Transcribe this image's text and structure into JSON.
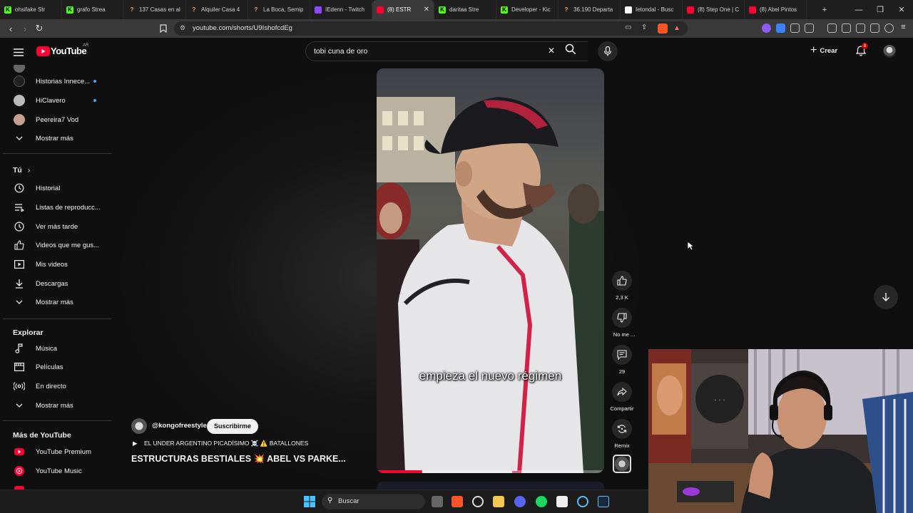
{
  "browser": {
    "tabs": [
      {
        "label": "ohsifake Str",
        "icon": "kick-icon",
        "color": "#53fc18"
      },
      {
        "label": "grafo Strea",
        "icon": "kick-icon",
        "color": "#53fc18"
      },
      {
        "label": "137 Casas en al",
        "icon": "question-icon",
        "color": "#f4a261"
      },
      {
        "label": "Alquiler Casa 4",
        "icon": "question-icon",
        "color": "#f4a261"
      },
      {
        "label": "La Boca, Semip",
        "icon": "question-icon",
        "color": "#f4a261"
      },
      {
        "label": "IEdenn - Twitch",
        "icon": "twitch-icon",
        "color": "#9146ff"
      },
      {
        "label": "(8) ESTR",
        "icon": "youtube-icon",
        "color": "#ff0033"
      },
      {
        "label": "daritaa Stre",
        "icon": "kick-icon",
        "color": "#53fc18"
      },
      {
        "label": "Developer - Kic",
        "icon": "kick-icon",
        "color": "#53fc18"
      },
      {
        "label": "36.190 Departa",
        "icon": "question-icon",
        "color": "#f4a261"
      },
      {
        "label": "Ietondal - Busc",
        "icon": "google-icon",
        "color": "#ffffff"
      },
      {
        "label": "(8) Step One | C",
        "icon": "youtube-icon",
        "color": "#ff0033"
      },
      {
        "label": "(8) Abel Pintos",
        "icon": "youtube-icon",
        "color": "#ff0033"
      }
    ],
    "url": "youtube.com/shorts/U9IshofcdEg"
  },
  "header": {
    "logo_text": "YouTube",
    "logo_region": "AR",
    "search_value": "tobi cuna de oro",
    "create_label": "Crear",
    "notif_count": "8"
  },
  "sidebar": {
    "subs": [
      {
        "label": "Historias Innece...",
        "dot": true
      },
      {
        "label": "HiClavero",
        "dot": true
      },
      {
        "label": "Peereira7 Vod",
        "dot": false
      }
    ],
    "show_more_1": "Mostrar más",
    "you_title": "Tú",
    "you_items": [
      {
        "label": "Historial",
        "icon": "history-icon"
      },
      {
        "label": "Listas de reproducc...",
        "icon": "playlist-icon"
      },
      {
        "label": "Ver más tarde",
        "icon": "clock-icon"
      },
      {
        "label": "Videos que me gus...",
        "icon": "thumb-up-icon"
      },
      {
        "label": "Mis videos",
        "icon": "play-box-icon"
      },
      {
        "label": "Descargas",
        "icon": "download-icon"
      }
    ],
    "show_more_2": "Mostrar más",
    "explore_title": "Explorar",
    "explore_items": [
      {
        "label": "Música",
        "icon": "music-note-icon"
      },
      {
        "label": "Películas",
        "icon": "film-icon"
      },
      {
        "label": "En directo",
        "icon": "live-icon"
      }
    ],
    "show_more_3": "Mostrar más",
    "more_title": "Más de YouTube",
    "more_items": [
      {
        "label": "YouTube Premium",
        "icon": "yt-premium-icon"
      },
      {
        "label": "YouTube Music",
        "icon": "yt-music-icon"
      }
    ]
  },
  "short": {
    "channel": "@kongofreestyle",
    "subscribe_label": "Suscribirme",
    "playlist_line": "EL UNDER ARGENTINO PICADÍSIMO ☠️ ⚠️ BATALLONES",
    "title": "ESTRUCTURAS BESTIALES 💥 ABEL VS PARKE...",
    "caption": "empieza el nuevo régimen",
    "likes": "2,3 K",
    "dislike_label": "No me ...",
    "comments": "29",
    "share_label": "Compartir",
    "remix_label": "Remix",
    "progress": 0.2
  },
  "taskbar": {
    "search_placeholder": "Buscar"
  }
}
